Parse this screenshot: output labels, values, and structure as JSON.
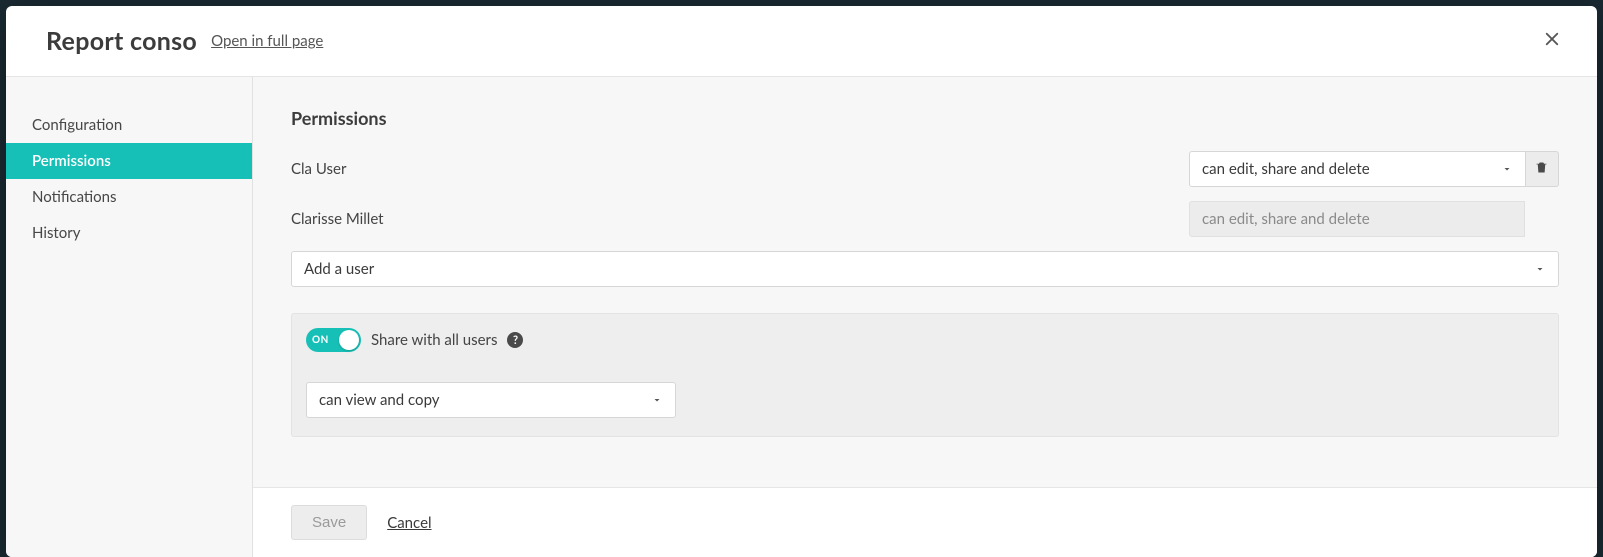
{
  "header": {
    "title": "Report conso",
    "open_full_label": "Open in full page"
  },
  "sidebar": {
    "items": [
      {
        "label": "Configuration",
        "active": false
      },
      {
        "label": "Permissions",
        "active": true
      },
      {
        "label": "Notifications",
        "active": false
      },
      {
        "label": "History",
        "active": false
      }
    ]
  },
  "permissions": {
    "section_title": "Permissions",
    "users": [
      {
        "name": "Cla User",
        "permission": "can edit, share and delete",
        "editable": true
      },
      {
        "name": "Clarisse Millet",
        "permission": "can edit, share and delete",
        "editable": false
      }
    ],
    "add_user_placeholder": "Add a user"
  },
  "share_all": {
    "toggle_on_label": "ON",
    "label": "Share with all users",
    "help_symbol": "?",
    "selected_permission": "can view and copy"
  },
  "footer": {
    "save_label": "Save",
    "cancel_label": "Cancel"
  }
}
